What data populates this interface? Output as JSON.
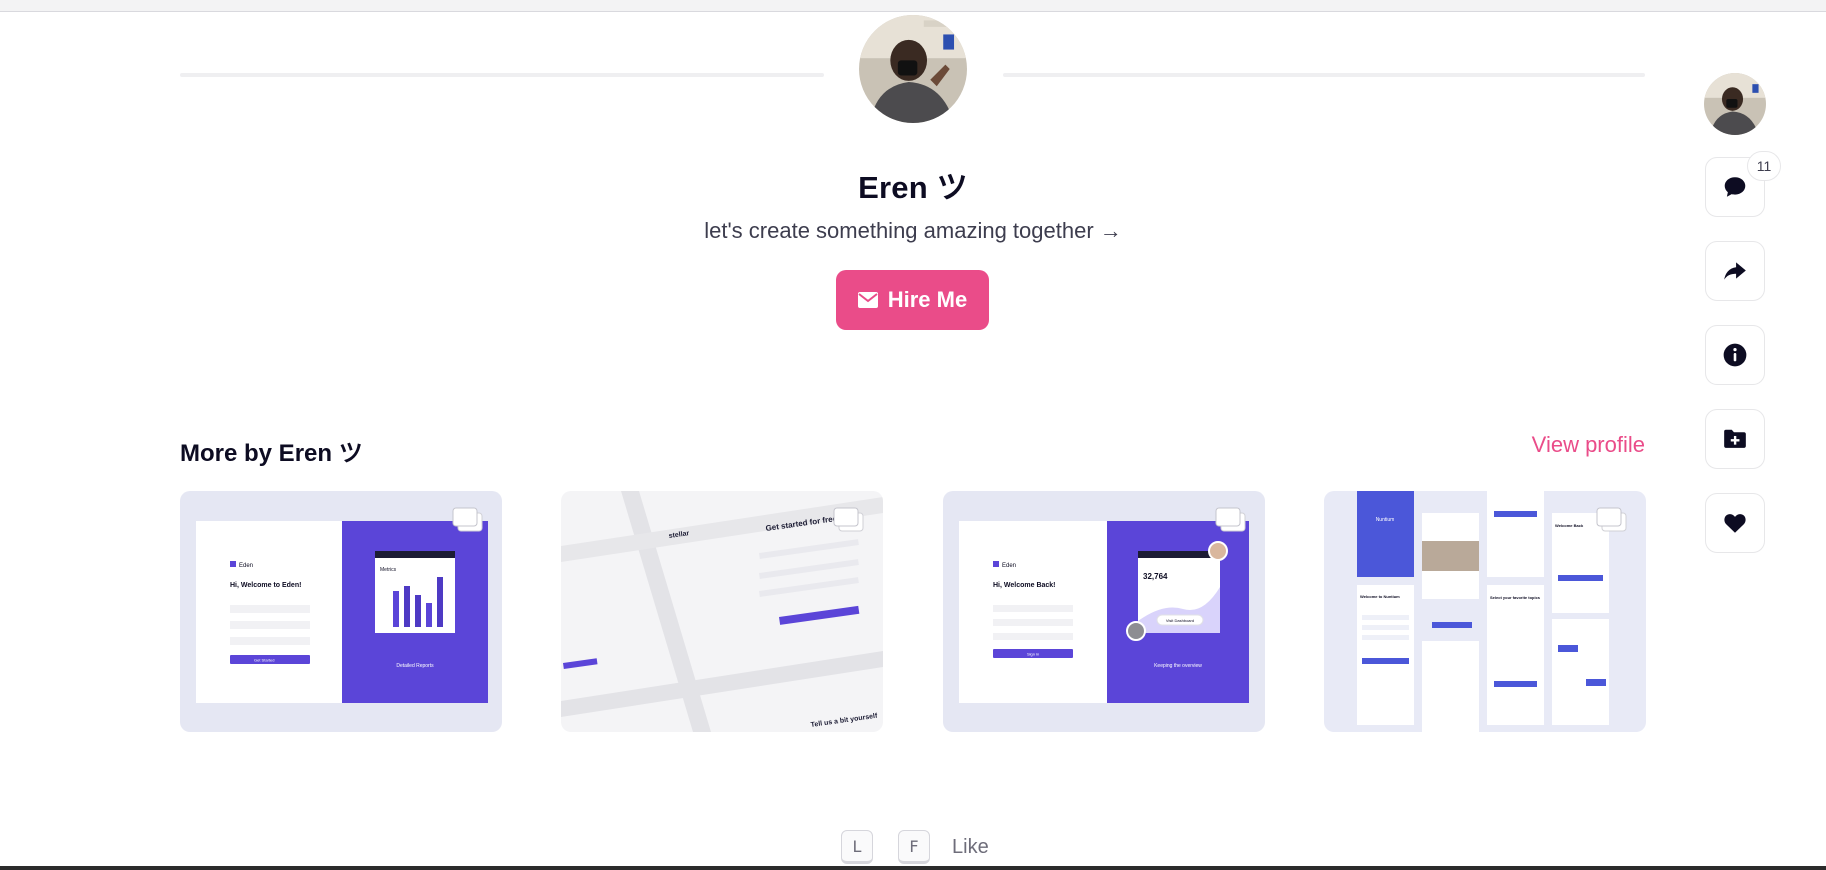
{
  "profile": {
    "name": "Eren ツ",
    "tagline": "let's create something amazing together →",
    "hire_label": "Hire Me"
  },
  "rail": {
    "comment_count": "11",
    "buttons": [
      "comment-icon",
      "share-icon",
      "info-icon",
      "add-to-collection-icon",
      "heart-icon"
    ]
  },
  "more_section": {
    "title": "More by Eren ツ",
    "view_profile_label": "View profile",
    "shots": [
      {
        "left_title": "Hi, Welcome to Eden!",
        "brand": "Eden",
        "panel_title": "Detailed Reports",
        "widget_title": "Metrics",
        "button_label": "Get Started"
      },
      {
        "brand": "stellar",
        "heading": "Get started for free",
        "footer_heading": "Tell us a bit yourself"
      },
      {
        "left_title": "Hi, Welcome Back!",
        "brand": "Eden",
        "stat_value": "32,764",
        "widget_button": "Visit Dashboard",
        "panel_title": "Keeping the overview",
        "button_label": "Sign in"
      },
      {
        "brand": "Nuntium",
        "heading_a": "Welcome to Nuntium",
        "heading_b": "Select your favorite topics",
        "heading_c": "Welcome Back"
      }
    ]
  },
  "shortcuts": {
    "key_l": "L",
    "key_f": "F",
    "like_label": "Like"
  },
  "colors": {
    "accent_pink": "#ea4c89",
    "accent_purple": "#5b45d8",
    "text_dark": "#0d0c22"
  }
}
